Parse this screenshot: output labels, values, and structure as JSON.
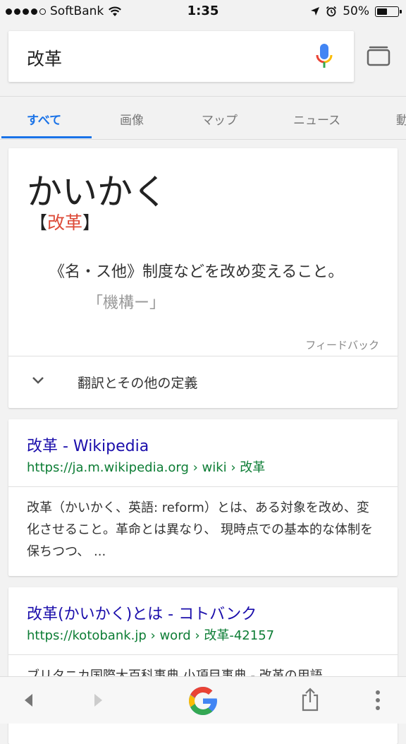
{
  "status": {
    "carrier": "SoftBank",
    "time": "1:35",
    "battery": "50%",
    "battery_level": 0.5
  },
  "search": {
    "query": "改革"
  },
  "tabs": [
    {
      "label": "すべて",
      "active": true
    },
    {
      "label": "画像"
    },
    {
      "label": "マップ"
    },
    {
      "label": "ニュース"
    },
    {
      "label": "動"
    }
  ],
  "dictionary": {
    "reading": "かいかく",
    "kanji_open": "【",
    "kanji": "改革",
    "kanji_close": "】",
    "definition": "《名・ス他》制度などを改め変えること。",
    "example": "「機構ー」",
    "feedback": "フィードバック",
    "expand_label": "翻訳とその他の定義"
  },
  "results": [
    {
      "title": "改革 - Wikipedia",
      "url": "https://ja.m.wikipedia.org › wiki › 改革",
      "snippet": "改革（かいかく、英語: reform）とは、ある対象を改め、変化させること。革命とは異なり、 現時点での基本的な体制を保ちつつ、 ..."
    },
    {
      "title": "改革(かいかく)とは - コトバンク",
      "url": "https://kotobank.jp › word › 改革-42157",
      "snippet": "ブリタニカ国際大百科事典 小項目事典 - 改革の用語"
    }
  ],
  "colors": {
    "accent": "#1a73e8",
    "link": "#1a0dab",
    "url": "#0d7d35",
    "kanji_red": "#dd4b39"
  }
}
